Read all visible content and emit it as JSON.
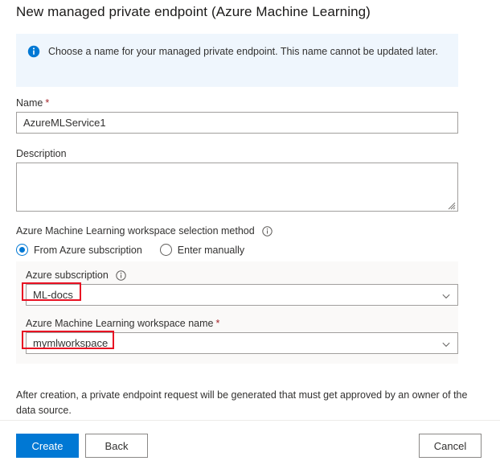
{
  "page": {
    "title": "New managed private endpoint (Azure Machine Learning)"
  },
  "info_banner": {
    "text": "Choose a name for your managed private endpoint. This name cannot be updated later.",
    "icon": "info-circle-icon",
    "background_color": "#eff6fd",
    "icon_color": "#0078d4"
  },
  "form": {
    "name": {
      "label": "Name",
      "required_marker": "*",
      "value": "AzureMLService1",
      "placeholder": ""
    },
    "description": {
      "label": "Description",
      "value": "",
      "placeholder": ""
    },
    "selection_method": {
      "label": "Azure Machine Learning workspace selection method",
      "hint_icon": "info-circle-outline-icon",
      "options": [
        {
          "label": "From Azure subscription",
          "selected": true
        },
        {
          "label": "Enter manually",
          "selected": false
        }
      ]
    },
    "subscription": {
      "label": "Azure subscription",
      "hint_icon": "info-circle-outline-icon",
      "value": "ML-docs",
      "chevron_icon": "chevron-down-icon",
      "highlighted": true
    },
    "workspace_name": {
      "label": "Azure Machine Learning workspace name",
      "required_marker": "*",
      "value": "mymlworkspace",
      "chevron_icon": "chevron-down-icon",
      "highlighted": true
    }
  },
  "footer": {
    "note": "After creation, a private endpoint request will be generated that must get approved by an owner of the data source.",
    "create_label": "Create",
    "back_label": "Back",
    "cancel_label": "Cancel"
  },
  "colors": {
    "primary": "#0078d4",
    "annotation": "#e81123",
    "required": "#a4262c",
    "panel": "#faf9f8",
    "border": "#a19f9d"
  }
}
